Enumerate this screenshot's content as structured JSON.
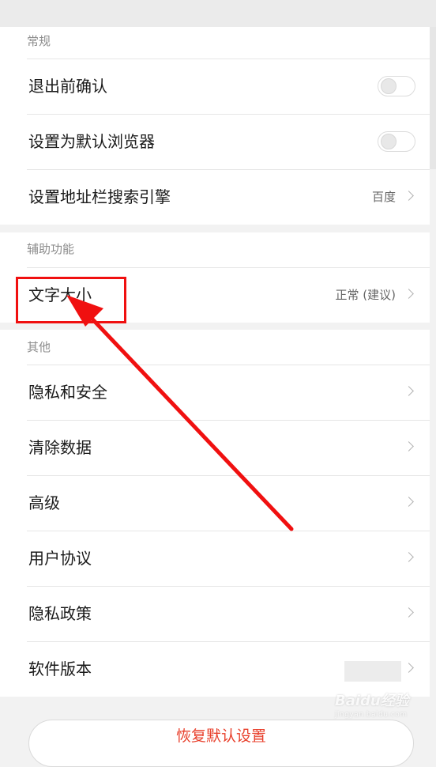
{
  "sections": [
    {
      "header": "常规",
      "rows": [
        {
          "label": "退出前确认",
          "control": "toggle",
          "toggle_on": false
        },
        {
          "label": "设置为默认浏览器",
          "control": "toggle",
          "toggle_on": false
        },
        {
          "label": "设置地址栏搜索引擎",
          "control": "chevron",
          "value": "百度"
        }
      ]
    },
    {
      "header": "辅助功能",
      "rows": [
        {
          "label": "文字大小",
          "control": "chevron",
          "value": "正常 (建议)"
        }
      ]
    },
    {
      "header": "其他",
      "rows": [
        {
          "label": "隐私和安全",
          "control": "chevron"
        },
        {
          "label": "清除数据",
          "control": "chevron"
        },
        {
          "label": "高级",
          "control": "chevron"
        },
        {
          "label": "用户协议",
          "control": "chevron"
        },
        {
          "label": "隐私政策",
          "control": "chevron"
        },
        {
          "label": "软件版本",
          "control": "chevron"
        }
      ]
    }
  ],
  "bottom_button": "恢复默认设置",
  "watermark": {
    "main": "Baidu经验",
    "sub": "jingyan.baidu.com"
  },
  "colors": {
    "annotation": "#f01010",
    "reset_button_text": "#e8402c"
  },
  "icons": {
    "chevron": "chevron-right-icon",
    "toggle": "toggle-switch"
  }
}
